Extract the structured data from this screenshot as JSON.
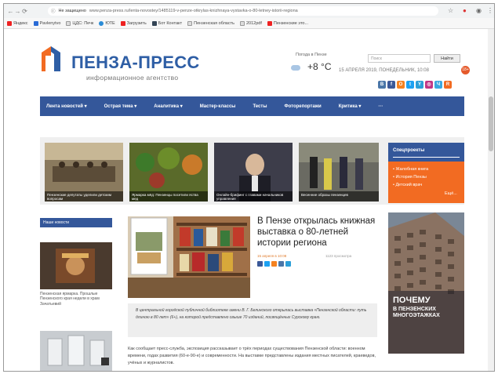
{
  "browser": {
    "url_prefix": "Не защищено",
    "url": "www.penza-press.ru/lenta-novostey/1485119-v-penze-otkrylas-knizhnaya-vystavka-o-80-letney-istorii-regiona",
    "bookmarks": [
      "Яндекс",
      "Pavlenytvo",
      "ЦДС: Печк",
      "ЮТЕ",
      "Загрузить",
      "Бот Контакт",
      "Пензенская область",
      "2012pdf",
      "Пензенские это..."
    ]
  },
  "site": {
    "brand": "ПЕНЗА-ПРЕСС",
    "subtitle": "информационное агентство",
    "weather_label": "Погода в Пензе",
    "temperature": "+8 °С",
    "date": "15 АПРЕЛЯ 2019, ПОНЕДЕЛЬНИК, 10:08",
    "age_badge": "18+",
    "search_placeholder": "Поиск",
    "search_button": "Найти",
    "socials": [
      "В",
      "f",
      "О",
      "t",
      "Y",
      "◎",
      "Ч",
      "R"
    ]
  },
  "menu": [
    "Лента новостей ▾",
    "Острая тема ▾",
    "Аналитика ▾",
    "Мастер-классы",
    "Тесты",
    "Фоторепортажи",
    "Критика ▾",
    "···"
  ],
  "features": [
    "Пензенские депутаты уделили детским вопросам",
    "Ярмарка мёд: Пензенцы посетили яства мед",
    "Онлайн-брифинг с главами начальников управления",
    "Весенние образы пензенцев"
  ],
  "special": {
    "title": "Спецпроекты",
    "items": [
      "• Жалобная книга",
      "• История Пензы",
      "• Детский врач",
      "Ещё..."
    ]
  },
  "left": {
    "header": "Наши новости",
    "caption": "Пензенская ярмарка. Прошлые Пензенского края недели в храм Зачатьевий"
  },
  "article": {
    "title": "В Пензе открылась книжная выставка о 80-летней истории региона",
    "meta": "15 апреля в 10:08",
    "views": "1123 просмотра",
    "lead": "В центральной городской публичной библиотеке имени В. Г. Белинского открылась выставка «Пензенской области: путь длиною в 80 лет» (6+), на которой представлено свыше 70 изданий, посвящённых Сурскому краю.",
    "body": "Как сообщает пресс-служба, экспозиция рассказывает о трёх периодах существования Пензенской области: военном времени, годах развития (60-е-90-е) и современности. На выставке представлены издания местных писателей, краеведов, учёных и журналистов."
  },
  "ad": {
    "line1": "ПОЧЕМУ",
    "line2": "В ПЕНЗЕНСКИХ МНОГОЭТАЖКАХ"
  }
}
